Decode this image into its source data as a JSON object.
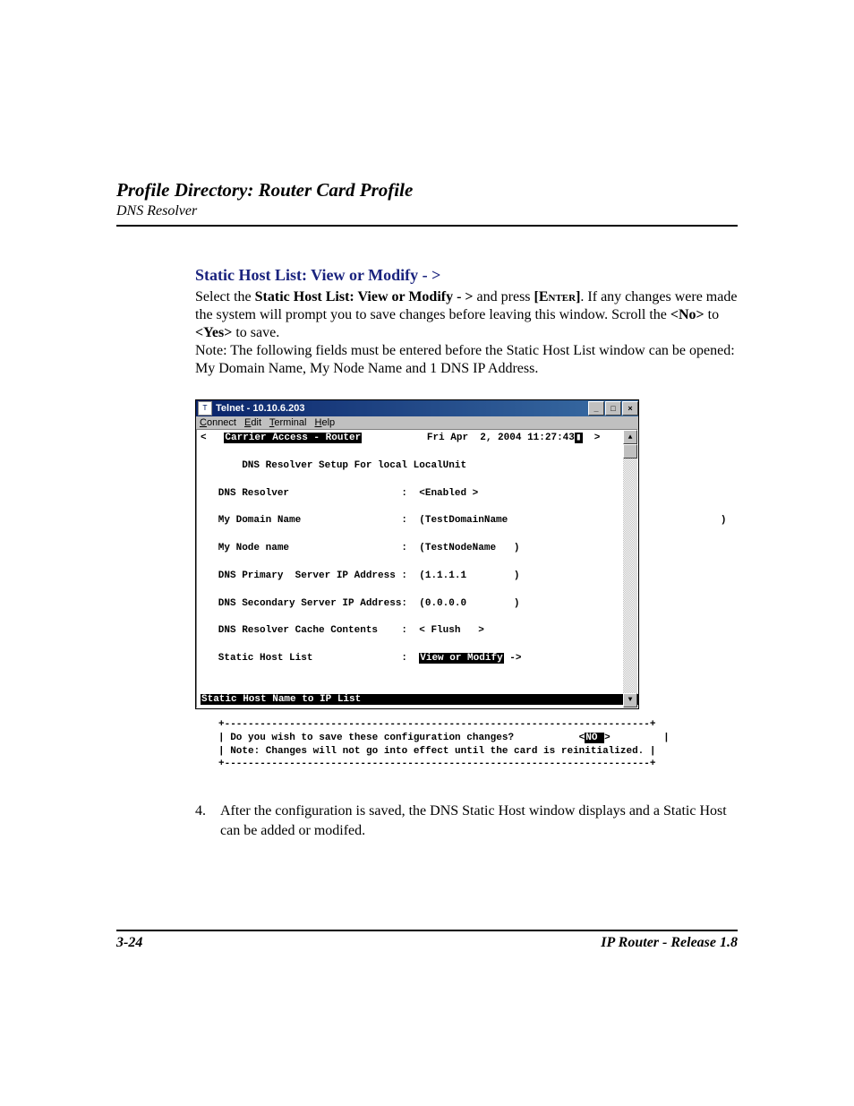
{
  "header": {
    "title": "Profile Directory: Router Card Profile",
    "subtitle": "DNS Resolver"
  },
  "section_title": "Static Host List: View or Modify - >",
  "para": {
    "p1_a": "Select the ",
    "p1_b": "Static Host List: View or Modify - >",
    "p1_c": " and press ",
    "enter": "[Enter]",
    "p1_d": ". If any changes were made the system will prompt you to save changes before leaving this window. Scroll the ",
    "no": "<No>",
    "p1_e": " to ",
    "yes": "<Yes>",
    "p1_f": " to save.",
    "p2": "Note: The following fields must be entered before the Static Host List window can be opened: My Domain Name, My Node Name and 1 DNS IP Address."
  },
  "telnet": {
    "title": "Telnet - 10.10.6.203",
    "menu": {
      "connect_u": "C",
      "connect_r": "onnect",
      "edit_u": "E",
      "edit_r": "dit",
      "terminal_u": "T",
      "terminal_r": "erminal",
      "help_u": "H",
      "help_r": "elp"
    },
    "btn_min": "_",
    "btn_max": "□",
    "btn_close": "×",
    "sb_up": "▲",
    "sb_down": "▼",
    "line_top_lt": "<   ",
    "top_banner": "Carrier Access - Router",
    "top_date": "           Fri Apr  2, 2004 11:27:43",
    "top_cursor": "▮",
    "top_right": "  >",
    "l_blank": "",
    "l_setup": "       DNS Resolver Setup For local LocalUnit",
    "fields": {
      "resolver_lbl": "   DNS Resolver                   :  ",
      "resolver_val": "<Enabled >",
      "domain_lbl": "   My Domain Name                 :  (",
      "domain_val": "TestDomainName",
      "domain_close": "                                    )",
      "node_lbl": "   My Node name                   :  (",
      "node_val": "TestNodeName",
      "node_close": "   )",
      "pri_lbl": "   DNS Primary  Server IP Address :  (",
      "pri_val": "1.1.1.1",
      "pri_close": "        )",
      "sec_lbl": "   DNS Secondary Server IP Address:  (",
      "sec_val": "0.0.0.0",
      "sec_close": "        )",
      "cache_lbl": "   DNS Resolver Cache Contents    :  ",
      "cache_val": "< Flush   >",
      "static_lbl": "   Static Host List               :  ",
      "static_val": "View or Modify",
      "static_arrow": " ->"
    },
    "bottom_bar": "Static Host Name to IP List                                               "
  },
  "dashbox": {
    "edge": "+------------------------------------------------------------------------+",
    "q_a": "| Do you wish to save these configuration changes?           <",
    "no_inv": "NO ",
    "q_b": ">         |",
    "note": "| Note: Changes will not go into effect until the card is reinitialized. |"
  },
  "step": {
    "num": "4.",
    "text": "After the configuration is saved, the DNS Static Host window displays and a Static Host can be added or modifed."
  },
  "footer": {
    "page": "3-24",
    "release": "IP Router - Release 1.8"
  }
}
